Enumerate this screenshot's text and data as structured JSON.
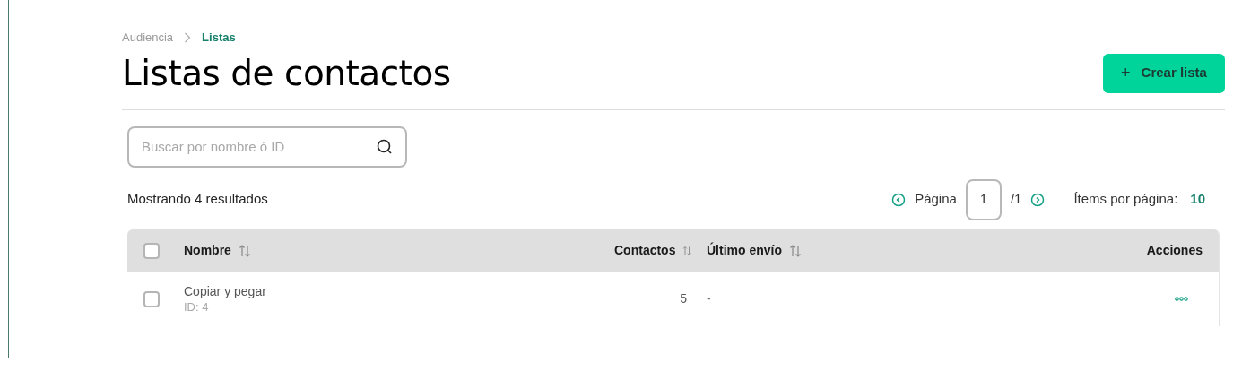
{
  "breadcrumb": [
    {
      "label": "Audiencia",
      "selected": false
    },
    {
      "label": "Listas",
      "selected": true
    }
  ],
  "title": "Listas de contactos",
  "create_button": {
    "label": "Crear lista",
    "icon": "+"
  },
  "search": {
    "placeholder": "Buscar por nombre ó ID"
  },
  "results": "Mostrando 4 resultados",
  "pagination": {
    "label": "Página",
    "page": "1",
    "total": "/1",
    "per_page_label": "Ítems por página:",
    "per_page": "10"
  },
  "table": {
    "all_checked": false,
    "columns": [
      {
        "label": "Nombre",
        "kind": "sortable"
      },
      {
        "label": "Contactos",
        "kind": "sortable"
      },
      {
        "label": "Último envío",
        "kind": "sortable"
      },
      {
        "label": "Acciones",
        "kind": "plain"
      }
    ],
    "rows": [
      {
        "checked": false,
        "name": "Copiar y pegar",
        "id": "ID: 4",
        "contacts": "5",
        "last_sent": "-"
      }
    ]
  }
}
